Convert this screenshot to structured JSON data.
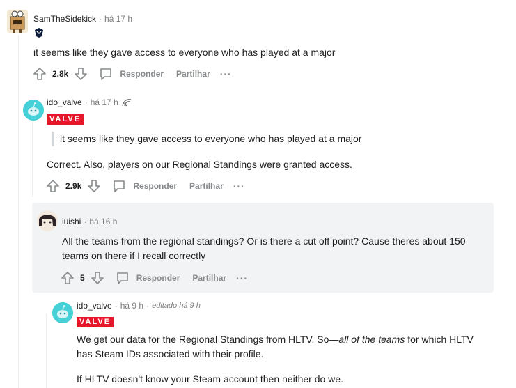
{
  "comments": [
    {
      "author": "SamTheSidekick",
      "time": "há 17 h",
      "body": "it seems like they gave access to everyone who has played at a major",
      "votes": "2.8k",
      "reply_label": "Responder",
      "share_label": "Partilhar",
      "more": "···"
    },
    {
      "author": "ido_valve",
      "time": "há 17 h",
      "flair": "VALVE",
      "quote": "it seems like they gave access to everyone who has played at a major",
      "body": "Correct. Also, players on our Regional Standings were granted access.",
      "votes": "2.9k",
      "reply_label": "Responder",
      "share_label": "Partilhar",
      "more": "···"
    },
    {
      "author": "iuishi",
      "time": "há 16 h",
      "body": "All the teams from the regional standings? Or is there a cut off point? Cause theres about 150 teams on there if I recall correctly",
      "votes": "5",
      "reply_label": "Responder",
      "share_label": "Partilhar",
      "more": "···"
    },
    {
      "author": "ido_valve",
      "time": "há 9 h",
      "edited": "editado há 9 h",
      "flair": "VALVE",
      "body_part1": "We get our data for the Regional Standings from HLTV. So—",
      "body_italic": "all of the teams",
      "body_part2": " for which HLTV has Steam IDs associated with their profile.",
      "body2": "If HLTV doesn't know your Steam account then neither do we."
    }
  ],
  "colors": {
    "accent": "#e6172b",
    "highlight": "#f1f3f5",
    "muted": "#878a8c"
  }
}
